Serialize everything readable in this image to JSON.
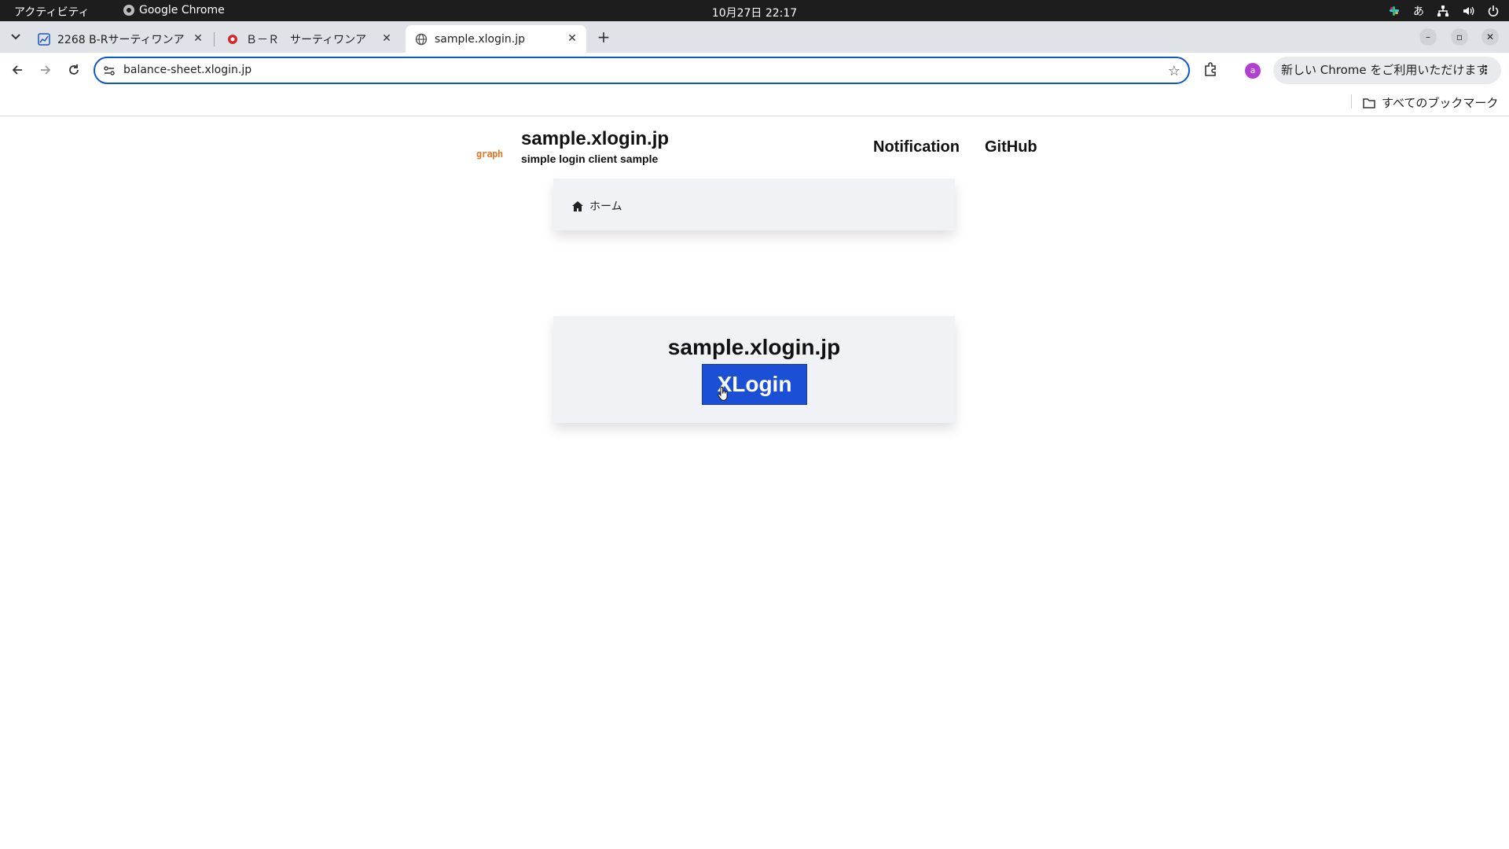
{
  "system_bar": {
    "activities": "アクティビティ",
    "app_name": "Google Chrome",
    "clock": "10月27日  22:17",
    "input_method": "あ"
  },
  "tabs": [
    {
      "title": "2268 B-Rサーティワンア",
      "icon": "chart-favicon",
      "active": false
    },
    {
      "title": "Ｂ－Ｒ　サーティワンア",
      "icon": "br31-favicon",
      "active": false
    },
    {
      "title": "sample.xlogin.jp",
      "icon": "globe-favicon",
      "active": true
    }
  ],
  "toolbar": {
    "url": "balance-sheet.xlogin.jp",
    "profile_initial": "a",
    "update_chip": "新しい Chrome をご利用いただけます"
  },
  "bookmarks": {
    "all_bookmarks": "すべてのブックマーク"
  },
  "site": {
    "logo_text": "graph",
    "title": "sample.xlogin.jp",
    "subtitle": "simple login client sample",
    "nav": {
      "notification": "Notification",
      "github": "GitHub"
    },
    "breadcrumb_home": "ホーム",
    "card_title": "sample.xlogin.jp",
    "login_button": "XLogin"
  },
  "colors": {
    "accent": "#0b57d0",
    "login_button": "#1a4fd6",
    "logo": "#e07b2b",
    "card_bg": "#f1f2f6"
  }
}
